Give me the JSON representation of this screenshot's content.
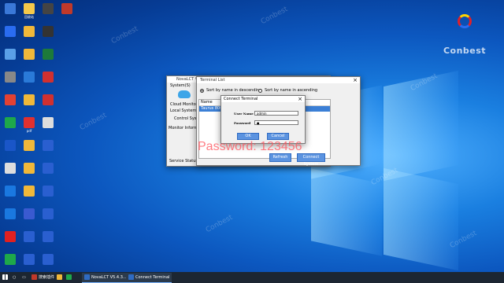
{
  "desktop": {
    "icons": [
      {
        "label": "",
        "color": "#3a78d8"
      },
      {
        "label": "回收站",
        "color": "#f5c94a"
      },
      {
        "label": "",
        "color": "#444"
      },
      {
        "label": "",
        "color": "#c0392b"
      },
      {
        "label": "",
        "color": "#2a6cf0"
      },
      {
        "label": "",
        "color": "#f0b83a"
      },
      {
        "label": "",
        "color": "#333"
      },
      {
        "label": "",
        "color": "#5aa0e8"
      },
      {
        "label": "",
        "color": "#f0b83a"
      },
      {
        "label": "",
        "color": "#1d7a3a"
      },
      {
        "label": "",
        "color": "#888"
      },
      {
        "label": "",
        "color": "#2a7ad8"
      },
      {
        "label": "",
        "color": "#d03030"
      },
      {
        "label": "",
        "color": "#e34133"
      },
      {
        "label": "",
        "color": "#f0b83a"
      },
      {
        "label": "",
        "color": "#d03030"
      },
      {
        "label": "",
        "color": "#1ea84a"
      },
      {
        "label": "pdf",
        "color": "#e03030"
      },
      {
        "label": "",
        "color": "#ddd"
      },
      {
        "label": "",
        "color": "#1a56c8"
      },
      {
        "label": "",
        "color": "#f0b83a"
      },
      {
        "label": "",
        "color": "#2a5fd0"
      },
      {
        "label": "",
        "color": "#ddd"
      },
      {
        "label": "",
        "color": "#f0b83a"
      },
      {
        "label": "",
        "color": "#2a5fd0"
      },
      {
        "label": "",
        "color": "#1a78e0"
      },
      {
        "label": "",
        "color": "#f0b83a"
      },
      {
        "label": "",
        "color": "#2a5fd0"
      },
      {
        "label": "",
        "color": "#1a78e0"
      },
      {
        "label": "",
        "color": "#3a5ad0"
      },
      {
        "label": "",
        "color": "#2a5fd0"
      },
      {
        "label": "",
        "color": "#e02020"
      },
      {
        "label": "",
        "color": "#2a5fd0"
      },
      {
        "label": "",
        "color": "#2a5fd0"
      },
      {
        "label": "",
        "color": "#1ea84a"
      },
      {
        "label": "",
        "color": "#2a5fd0"
      },
      {
        "label": "",
        "color": "#2a5fd0"
      }
    ],
    "logo_text": "Conbest",
    "watermark": "Conbest"
  },
  "app_window": {
    "title": "NovaLCT V5.4.3 - Terminal List",
    "menu": [
      "System(S)",
      "Se"
    ],
    "side_labels": [
      "Cloud Monitoring",
      "Local System Info",
      "Control System",
      "Monitor Information"
    ],
    "right_label": "ctTool",
    "status": "Service Status"
  },
  "terminal_list": {
    "title": "Terminal List",
    "sort_desc": "Sort by name in descending",
    "sort_asc": "Sort by name in ascending",
    "col_name": "Name",
    "row": "Taurus 8000",
    "refresh": "Refresh",
    "connect": "Connect System"
  },
  "dialog": {
    "title": "Connect Terminal",
    "user_label": "User Name",
    "user_value": "admin",
    "pwd_label": "Password",
    "pwd_value": "●",
    "ok": "OK",
    "cancel": "Cancel"
  },
  "overlay": {
    "password_text": "Password: 123456"
  },
  "taskbar": {
    "search": "搜索插件",
    "items": [
      {
        "label": "NovaLCT V5.4.3..."
      },
      {
        "label": "Connect Terminal"
      }
    ]
  }
}
